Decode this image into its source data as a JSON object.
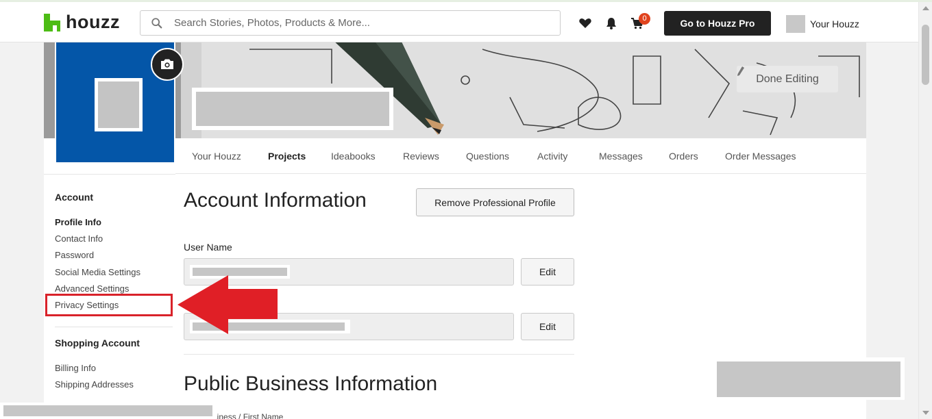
{
  "header": {
    "logo_text": "houzz",
    "search_placeholder": "Search Stories, Photos, Products & More...",
    "cart_count": "0",
    "pro_button": "Go to Houzz Pro",
    "user_menu": "Your Houzz"
  },
  "profile": {
    "done_editing": "Done Editing"
  },
  "tabs": [
    "Your Houzz",
    "Projects",
    "Ideabooks",
    "Reviews",
    "Questions",
    "Activity",
    "Messages",
    "Orders",
    "Order Messages"
  ],
  "active_tab": "Projects",
  "sidebar": {
    "account_title": "Account",
    "account_items": [
      "Profile Info",
      "Contact Info",
      "Password",
      "Social Media Settings",
      "Advanced Settings",
      "Privacy Settings"
    ],
    "shopping_title": "Shopping Account",
    "shopping_items": [
      "Billing Info",
      "Shipping Addresses"
    ]
  },
  "main": {
    "title": "Account Information",
    "remove_button": "Remove Professional Profile",
    "username_label": "User Name",
    "edit_label": "Edit",
    "section2_title": "Public Business Information",
    "cut_text": "usiness / First Name"
  },
  "colors": {
    "brand_green": "#4dbc15",
    "avatar_blue": "#0456a8",
    "highlight_red": "#d9222a",
    "cart_badge": "#e0431e"
  }
}
